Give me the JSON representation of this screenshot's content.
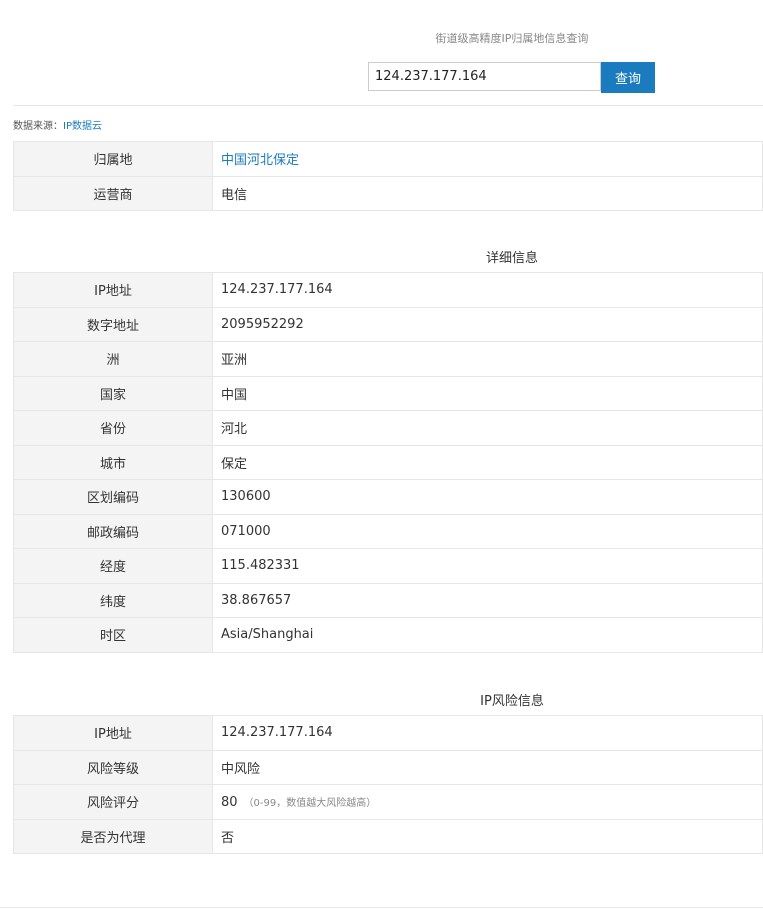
{
  "header": {
    "title": "街道级高精度IP归属地信息查询",
    "search_value": "124.237.177.164",
    "search_button": "查询"
  },
  "source": {
    "label": "数据来源：",
    "link": "IP数据云"
  },
  "summary": [
    {
      "k": "归属地",
      "v": "中国河北保定"
    },
    {
      "k": "运营商",
      "v": "电信"
    }
  ],
  "detail": {
    "title": "详细信息",
    "rows": [
      {
        "k": "IP地址",
        "v": "124.237.177.164"
      },
      {
        "k": "数字地址",
        "v": "2095952292"
      },
      {
        "k": "洲",
        "v": "亚洲"
      },
      {
        "k": "国家",
        "v": "中国"
      },
      {
        "k": "省份",
        "v": "河北"
      },
      {
        "k": "城市",
        "v": "保定"
      },
      {
        "k": "区划编码",
        "v": "130600"
      },
      {
        "k": "邮政编码",
        "v": "071000"
      },
      {
        "k": "经度",
        "v": "115.482331"
      },
      {
        "k": "纬度",
        "v": "38.867657"
      },
      {
        "k": "时区",
        "v": "Asia/Shanghai"
      }
    ]
  },
  "risk": {
    "title": "IP风险信息",
    "rows": [
      {
        "k": "IP地址",
        "v": "124.237.177.164"
      },
      {
        "k": "风险等级",
        "v": "中风险"
      },
      {
        "k": "风险评分",
        "v": "80",
        "note": "（0-99，数值越大风险越高）"
      },
      {
        "k": "是否为代理",
        "v": "否"
      }
    ]
  }
}
